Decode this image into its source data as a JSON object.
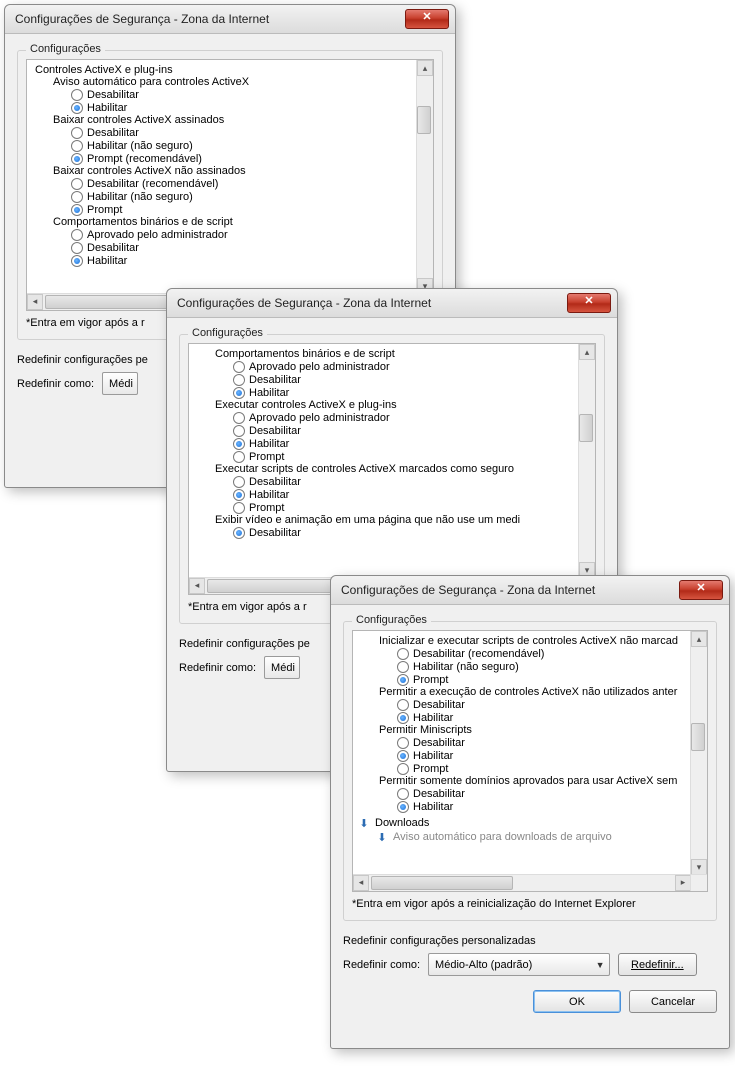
{
  "dialog_title": "Configurações de Segurança - Zona da Internet",
  "group_title": "Configurações",
  "note_text": "*Entra em vigor após a reinicialização do Internet Explorer",
  "reset_section_title": "Redefinir configurações personalizadas",
  "reset_label": "Redefinir como:",
  "reset_combo_value": "Médio-Alto (padrão)",
  "reset_button": "Redefinir...",
  "ok_button": "OK",
  "cancel_button": "Cancelar",
  "close_glyph": "✕",
  "combo_partial": "Médi",
  "note_partial": "*Entra em vigor após a r",
  "reset_section_partial": "Redefinir configurações pe",
  "d1": {
    "root": "Controles ActiveX e plug-ins",
    "cat1": "Aviso automático para controles ActiveX",
    "cat1_o1": "Desabilitar",
    "cat1_o2": "Habilitar",
    "cat2": "Baixar controles ActiveX assinados",
    "cat2_o1": "Desabilitar",
    "cat2_o2": "Habilitar (não seguro)",
    "cat2_o3": "Prompt (recomendável)",
    "cat3": "Baixar controles ActiveX não assinados",
    "cat3_o1": "Desabilitar (recomendável)",
    "cat3_o2": "Habilitar (não seguro)",
    "cat3_o3": "Prompt",
    "cat4": "Comportamentos binários e de script",
    "cat4_o1": "Aprovado pelo administrador",
    "cat4_o2": "Desabilitar",
    "cat4_o3": "Habilitar"
  },
  "d2": {
    "cat1": "Comportamentos binários e de script",
    "cat1_o1": "Aprovado pelo administrador",
    "cat1_o2": "Desabilitar",
    "cat1_o3": "Habilitar",
    "cat2": "Executar controles ActiveX e plug-ins",
    "cat2_o1": "Aprovado pelo administrador",
    "cat2_o2": "Desabilitar",
    "cat2_o3": "Habilitar",
    "cat2_o4": "Prompt",
    "cat3": "Executar scripts de controles ActiveX marcados como seguro",
    "cat3_o1": "Desabilitar",
    "cat3_o2": "Habilitar",
    "cat3_o3": "Prompt",
    "cat4": "Exibir vídeo e animação em uma página que não use um medi",
    "cat4_o1": "Desabilitar"
  },
  "d3": {
    "cat1": "Inicializar e executar scripts de controles ActiveX não marcad",
    "cat1_o1": "Desabilitar (recomendável)",
    "cat1_o2": "Habilitar (não seguro)",
    "cat1_o3": "Prompt",
    "cat2": "Permitir a execução de controles ActiveX não utilizados anter",
    "cat2_o1": "Desabilitar",
    "cat2_o2": "Habilitar",
    "cat3": "Permitir Miniscripts",
    "cat3_o1": "Desabilitar",
    "cat3_o2": "Habilitar",
    "cat3_o3": "Prompt",
    "cat4": "Permitir somente domínios aprovados para usar ActiveX sem",
    "cat4_o1": "Desabilitar",
    "cat4_o2": "Habilitar",
    "dls": "Downloads",
    "dls_sub": "Aviso automático para downloads de arquivo"
  }
}
